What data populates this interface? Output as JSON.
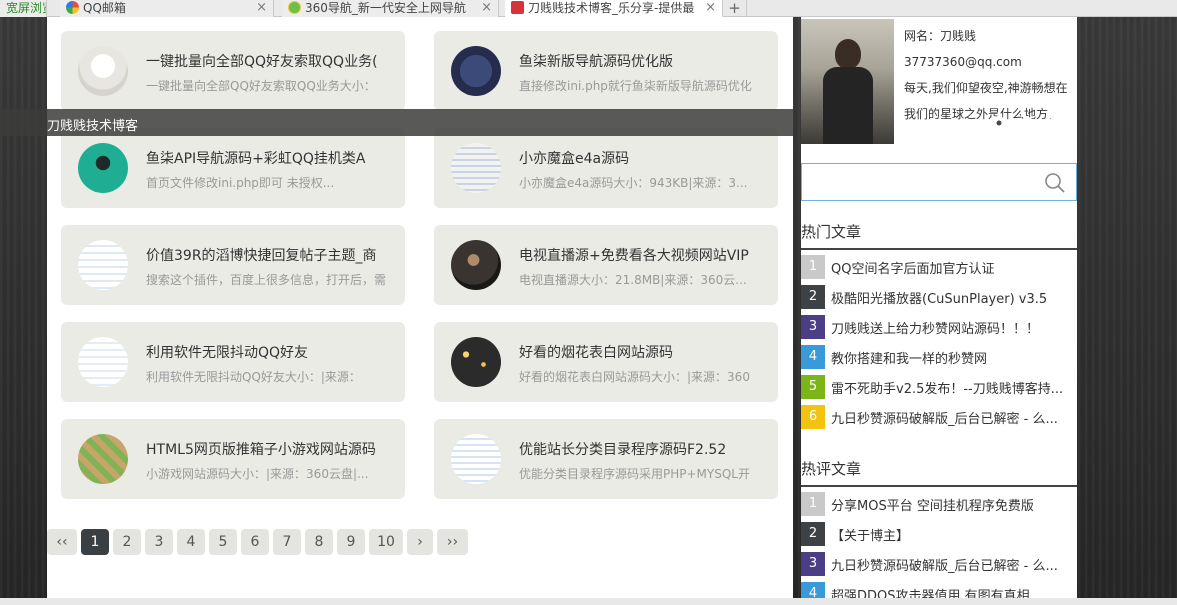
{
  "browser": {
    "tabs": [
      {
        "label": "宽屏浏览",
        "active": false
      },
      {
        "label": "QQ邮箱",
        "active": false
      },
      {
        "label": "360导航_新一代安全上网导航",
        "active": false
      },
      {
        "label": "刀贱贱技术博客_乐分享-提供最",
        "active": true
      }
    ],
    "close_glyph": "×",
    "add_glyph": "+"
  },
  "header": {
    "brand": "刀贱贱技术博客"
  },
  "cards": [
    {
      "title": "一键批量向全部QQ好友索取QQ业务(",
      "desc": "一键批量向全部QQ好友索取QQ业务大小：",
      "thumb": "light"
    },
    {
      "title": "鱼柒新版导航源码优化版",
      "desc": "直接修改ini.php就行鱼柒新版导航源码优化",
      "thumb": "dark"
    },
    {
      "title": "鱼柒API导航源码+彩虹QQ挂机类A",
      "desc": "首页文件修改ini.php即可 未授权...",
      "thumb": "teal"
    },
    {
      "title": "小亦魔盒e4a源码",
      "desc": "小亦魔盒e4a源码大小：943KB|来源：3...",
      "thumb": "light"
    },
    {
      "title": "价值39R的滔博快捷回复帖子主题_商",
      "desc": "搜索这个插件，百度上很多信息，打开后，需",
      "thumb": "light"
    },
    {
      "title": "电视直播源+免费看各大视频网站VIP",
      "desc": "电视直播源大小：21.8MB|来源：360云...",
      "thumb": "photo"
    },
    {
      "title": "利用软件无限抖动QQ好友",
      "desc": "利用软件无限抖动QQ好友大小：|来源：",
      "thumb": "light"
    },
    {
      "title": "好看的烟花表白网站源码",
      "desc": "好看的烟花表白网站源码大小：|来源：360",
      "thumb": "night"
    },
    {
      "title": "HTML5网页版推箱子小游戏网站源码",
      "desc": "小游戏网站源码大小：|来源：360云盘|...",
      "thumb": "game"
    },
    {
      "title": "优能站长分类目录程序源码F2.52",
      "desc": "优能分类目录程序源码采用PHP+MYSQL开",
      "thumb": "light"
    }
  ],
  "pagination": {
    "items": [
      "‹‹",
      "1",
      "2",
      "3",
      "4",
      "5",
      "6",
      "7",
      "8",
      "9",
      "10",
      "›",
      "››"
    ],
    "current": "1"
  },
  "sidebar": {
    "profile": {
      "name": "网名：刀贱贱",
      "email": "37737360@qq.com",
      "bio": "每天,我们仰望夜空,神游畅想在我们的星球之外是什么地方。"
    },
    "search": {
      "placeholder": ""
    },
    "hot": {
      "title": "热门文章",
      "items": [
        {
          "n": "1",
          "title": "QQ空间名字后面加官方认证",
          "color": "#c9c9c9"
        },
        {
          "n": "2",
          "title": "极酷阳光播放器(CuSunPlayer) v3.5",
          "color": "#3d4247"
        },
        {
          "n": "3",
          "title": "刀贱贱送上给力秒赞网站源码！！！",
          "color": "#4b3e87"
        },
        {
          "n": "4",
          "title": "教你搭建和我一样的秒赞网",
          "color": "#3a9ad9"
        },
        {
          "n": "5",
          "title": "雷不死助手v2.5发布！--刀贱贱博客持...",
          "color": "#7cb518"
        },
        {
          "n": "6",
          "title": "九日秒赞源码破解版_后台已解密 - 么...",
          "color": "#f2c30f"
        }
      ]
    },
    "comments": {
      "title": "热评文章",
      "items": [
        {
          "n": "1",
          "title": "分享MOS平台 空间挂机程序免费版",
          "color": "#c9c9c9"
        },
        {
          "n": "2",
          "title": "【关于博主】",
          "color": "#3d4247"
        },
        {
          "n": "3",
          "title": "九日秒赞源码破解版_后台已解密 - 么...",
          "color": "#4b3e87"
        },
        {
          "n": "4",
          "title": "超强DDOS攻击器值用,有图有真相",
          "color": "#3a9ad9"
        }
      ]
    },
    "icons": [
      "settings-icon",
      "rss-icon",
      "mail-icon"
    ]
  }
}
